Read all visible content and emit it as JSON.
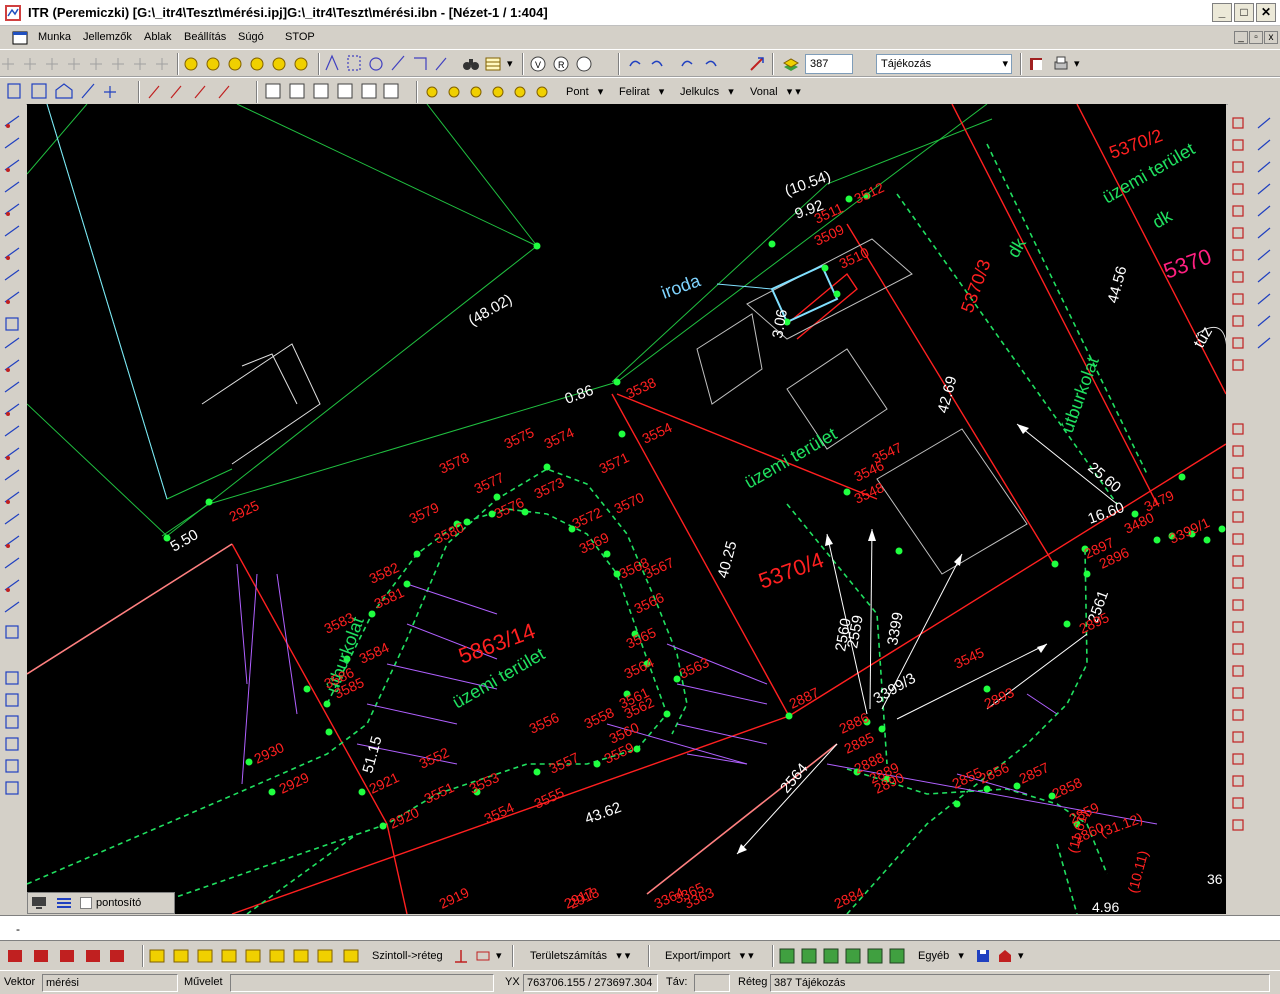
{
  "window": {
    "title": "ITR  (Peremiczki)  [G:\\_itr4\\Teszt\\mérési.ipj]G:\\_itr4\\Teszt\\mérési.ibn - [Nézet-1 / 1:404]",
    "min": "_",
    "max": "□",
    "close": "✕"
  },
  "menu": {
    "items": [
      "Munka",
      "Jellemzők",
      "Ablak",
      "Beállítás",
      "Súgó",
      "STOP"
    ]
  },
  "toolbar1": {
    "layer_value": "387",
    "layer_name": "Tájékozás"
  },
  "toolbar2": {
    "pont": "Pont",
    "felirat": "Felirat",
    "jelkulcs": "Jelkulcs",
    "vonal": "Vonal"
  },
  "bottom_tabs": {
    "label": "pontosító"
  },
  "cmdline": {
    "text": "-"
  },
  "toolbar_bottom": {
    "szintoll": "Szintoll->réteg",
    "terulet": "Területszámítás",
    "export": "Export/import",
    "egyeb": "Egyéb"
  },
  "status": {
    "vektor_label": "Vektor",
    "vektor_value": "mérési",
    "muvelet_label": "Művelet",
    "yx_label": "YX",
    "yx_value": "763706.155 / 273697.304",
    "tav_label": "Táv:",
    "reteg_label": "Réteg",
    "reteg_value": "387  Tájékozás"
  },
  "map": {
    "parcels": [
      "5370/2",
      "5370/3",
      "5370/4",
      "5863/14",
      "5370"
    ],
    "area_labels": [
      "üzemi terület",
      "üzemi terület",
      "üzemi terület",
      "útburkolat",
      "útburkolat",
      "dk",
      "dk",
      "iroda"
    ],
    "distances": [
      "(10.54)",
      "9.92",
      "(48.02)",
      "0.86",
      "5.50",
      "42.69",
      "44.56",
      "40.25",
      "51.15",
      "43.62",
      "16.60",
      "25.60",
      "2560",
      "2559",
      "2561",
      "2564",
      "3399",
      "3399/3",
      "3.06"
    ],
    "points": [
      "3509",
      "3510",
      "3511",
      "3512",
      "3538",
      "3554",
      "3546",
      "3547",
      "3548",
      "2925",
      "3575",
      "3574",
      "3578",
      "3577",
      "3576",
      "3573",
      "3571",
      "3572",
      "3570",
      "3579",
      "3580",
      "3569",
      "3567",
      "3568",
      "3566",
      "3565",
      "3564",
      "3563",
      "3562",
      "3561",
      "3582",
      "3581",
      "3583",
      "3584",
      "3585",
      "3586",
      "2930",
      "2929",
      "2921",
      "2920",
      "3552",
      "3551",
      "3553",
      "3554",
      "3555",
      "3556",
      "3557",
      "3558",
      "3559",
      "3560",
      "2887",
      "2885",
      "2888",
      "2889",
      "2890",
      "2886",
      "2893",
      "2895",
      "2896",
      "2897",
      "3545",
      "2855",
      "2856",
      "2857",
      "2858",
      "2859",
      "2860",
      "2884",
      "2919",
      "2917",
      "2918",
      "3479",
      "3480",
      "3399/1",
      "3364",
      "3365",
      "3363"
    ],
    "dims_parens": [
      "(31.12)",
      "(11.61)",
      "(10.11)",
      "4.96",
      "36"
    ],
    "other": [
      "tűz"
    ]
  }
}
